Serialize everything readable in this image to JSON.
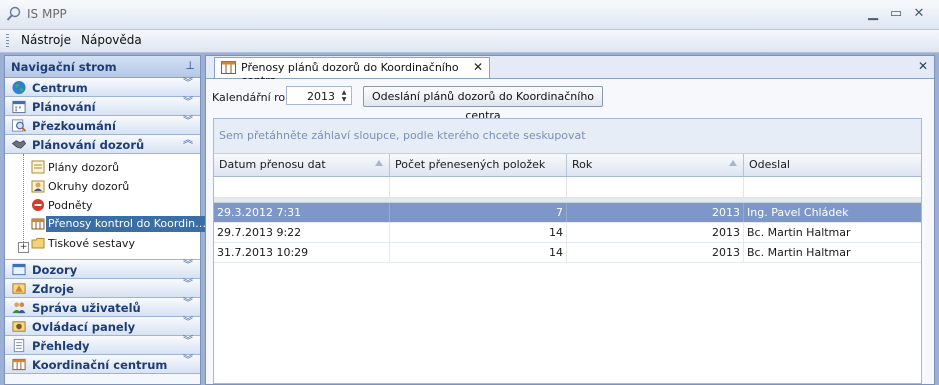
{
  "window": {
    "title": "IS MPP"
  },
  "menu": {
    "items": [
      "Nástroje",
      "Nápověda"
    ]
  },
  "nav": {
    "header": "Navigační strom",
    "groups_top": [
      {
        "label": "Centrum",
        "icon": "globe-icon"
      },
      {
        "label": "Plánování",
        "icon": "calendar-icon"
      },
      {
        "label": "Přezkoumání",
        "icon": "magnifier-icon"
      },
      {
        "label": "Plánování dozorů",
        "icon": "handshake-icon"
      }
    ],
    "tree_items": [
      {
        "label": "Plány dozorů",
        "icon": "plan-icon"
      },
      {
        "label": "Okruhy dozorů",
        "icon": "person-icon"
      },
      {
        "label": "Podněty",
        "icon": "stop-icon"
      },
      {
        "label": "Přenosy kontrol do Koordin…",
        "icon": "table-icon",
        "selected": true
      },
      {
        "label": "Tiskové sestavy",
        "icon": "folder-icon"
      }
    ],
    "groups_bottom": [
      {
        "label": "Dozory",
        "icon": "window-icon"
      },
      {
        "label": "Zdroje",
        "icon": "warning-icon"
      },
      {
        "label": "Správa uživatelů",
        "icon": "users-icon"
      },
      {
        "label": "Ovládací panely",
        "icon": "panel-icon"
      },
      {
        "label": "Přehledy",
        "icon": "document-icon"
      },
      {
        "label": "Koordinační centrum",
        "icon": "grid-icon"
      }
    ]
  },
  "tab": {
    "title": "Přenosy plánů dozorů do Koordinačního centra"
  },
  "toolbar": {
    "year_label": "Kalendářní rok",
    "year_value": "2013",
    "send_button": "Odeslání plánů dozorů do Koordinačního centra"
  },
  "grid": {
    "group_hint": "Sem přetáhněte záhlaví sloupce, podle kterého chcete seskupovat",
    "columns": [
      "Datum přenosu dat",
      "Počet přenesených položek",
      "Rok",
      "Odeslal"
    ],
    "rows": [
      {
        "date": "29.3.2012 7:31",
        "count": "7",
        "year": "2013",
        "sender": "Ing. Pavel Chládek",
        "selected": true
      },
      {
        "date": "29.7.2013 9:22",
        "count": "14",
        "year": "2013",
        "sender": "Bc. Martin Haltmar",
        "selected": false
      },
      {
        "date": "31.7.2013 10:29",
        "count": "14",
        "year": "2013",
        "sender": "Bc. Martin Haltmar",
        "selected": false
      }
    ]
  }
}
